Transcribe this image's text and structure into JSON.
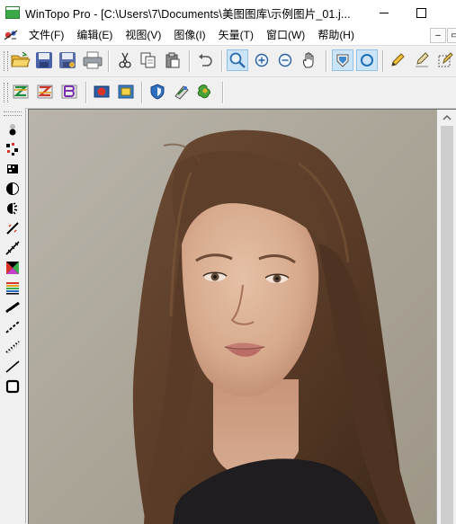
{
  "window": {
    "title": "WinTopo Pro - [C:\\Users\\7\\Documents\\美图图库\\示例图片_01.j..."
  },
  "menu": {
    "items": [
      {
        "id": "file",
        "label": "文件(F)"
      },
      {
        "id": "edit",
        "label": "编辑(E)"
      },
      {
        "id": "view",
        "label": "视图(V)"
      },
      {
        "id": "image",
        "label": "图像(I)"
      },
      {
        "id": "vector",
        "label": "矢量(T)"
      },
      {
        "id": "window",
        "label": "窗口(W)"
      },
      {
        "id": "help",
        "label": "帮助(H)"
      }
    ],
    "mdi_minimize": "–",
    "mdi_restore": "▭"
  },
  "toolbar1": {
    "icons": [
      "open-folder-icon",
      "save-icon",
      "save-as-icon",
      "print-icon",
      "cut-icon",
      "copy-icon",
      "paste-icon",
      "undo-icon",
      "zoom-tool-icon",
      "zoom-in-icon",
      "zoom-out-icon",
      "pan-hand-icon",
      "view-raster-icon",
      "view-vector-icon",
      "pencil-icon",
      "edit-pen-icon",
      "select-edit-icon"
    ],
    "active": [
      "zoom-tool-icon",
      "view-raster-icon",
      "view-vector-icon"
    ]
  },
  "toolbar2": {
    "icons": [
      "convert-raster-1-icon",
      "convert-raster-2-icon",
      "convert-raster-3-icon",
      "georeference-icon",
      "calibrate-icon",
      "shield-icon",
      "layers-icon",
      "colorize-icon"
    ]
  },
  "left_tools": {
    "icons": [
      "threshold-tool-icon",
      "point-reduce-tool-icon",
      "dither-tool-icon",
      "half-contrast-tool-icon",
      "invert-tool-icon",
      "line-extract-tool-icon",
      "line-trace-tool-icon",
      "color-palette-tool-icon",
      "color-bands-tool-icon",
      "smooth-line-tool-icon",
      "dashed-line-tool-icon",
      "dotted-line-tool-icon",
      "thin-line-tool-icon",
      "rectangle-tool-icon"
    ]
  },
  "colors": {
    "accent_active": "#cce4f7",
    "canvas_bg": "#aaaaaa"
  }
}
